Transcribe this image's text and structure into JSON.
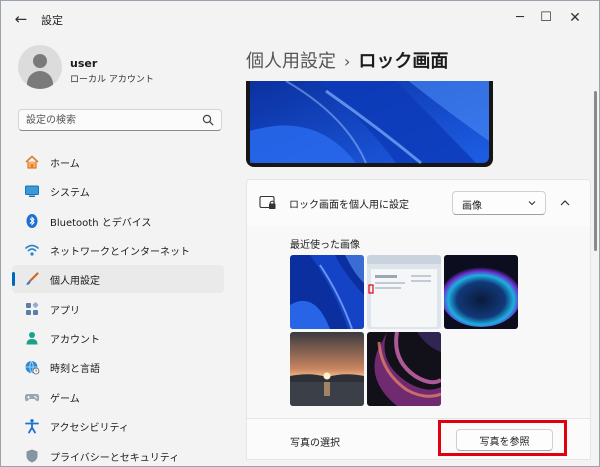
{
  "window": {
    "title": "設定",
    "back_icon": "arrow-left-icon",
    "controls": [
      "minimize-icon",
      "maximize-icon",
      "close-icon"
    ]
  },
  "account": {
    "name": "user",
    "type": "ローカル アカウント"
  },
  "search": {
    "placeholder": "設定の検索",
    "value": ""
  },
  "sidebar": {
    "items": [
      {
        "label": "ホーム",
        "icon": "home-icon",
        "selected": false
      },
      {
        "label": "システム",
        "icon": "monitor-icon",
        "selected": false
      },
      {
        "label": "Bluetooth とデバイス",
        "icon": "bluetooth-icon",
        "selected": false
      },
      {
        "label": "ネットワークとインターネット",
        "icon": "wifi-icon",
        "selected": false
      },
      {
        "label": "個人用設定",
        "icon": "paintbrush-icon",
        "selected": true
      },
      {
        "label": "アプリ",
        "icon": "apps-icon",
        "selected": false
      },
      {
        "label": "アカウント",
        "icon": "person-icon",
        "selected": false
      },
      {
        "label": "時刻と言語",
        "icon": "globe-clock-icon",
        "selected": false
      },
      {
        "label": "ゲーム",
        "icon": "gamepad-icon",
        "selected": false
      },
      {
        "label": "アクセシビリティ",
        "icon": "accessibility-icon",
        "selected": false
      },
      {
        "label": "プライバシーとセキュリティ",
        "icon": "shield-icon",
        "selected": false
      }
    ]
  },
  "breadcrumb": {
    "parent": "個人用設定",
    "separator": "›",
    "current": "ロック画面"
  },
  "lock_screen": {
    "setting_label": "ロック画面を個人用に設定",
    "setting_icon": "lock-screen-icon",
    "dropdown_value": "画像",
    "recent_title": "最近使った画像",
    "recent_images": [
      "blue-bloom-wallpaper",
      "settings-window-screenshot",
      "dark-glow-wallpaper",
      "sunset-lake-wallpaper",
      "purple-ribbon-wallpaper"
    ],
    "choose_label": "写真の選択",
    "browse_button": "写真を参照"
  },
  "colors": {
    "accent": "#0067c0",
    "highlight_box": "#e0000f",
    "window_bg": "#f3f3f3"
  }
}
